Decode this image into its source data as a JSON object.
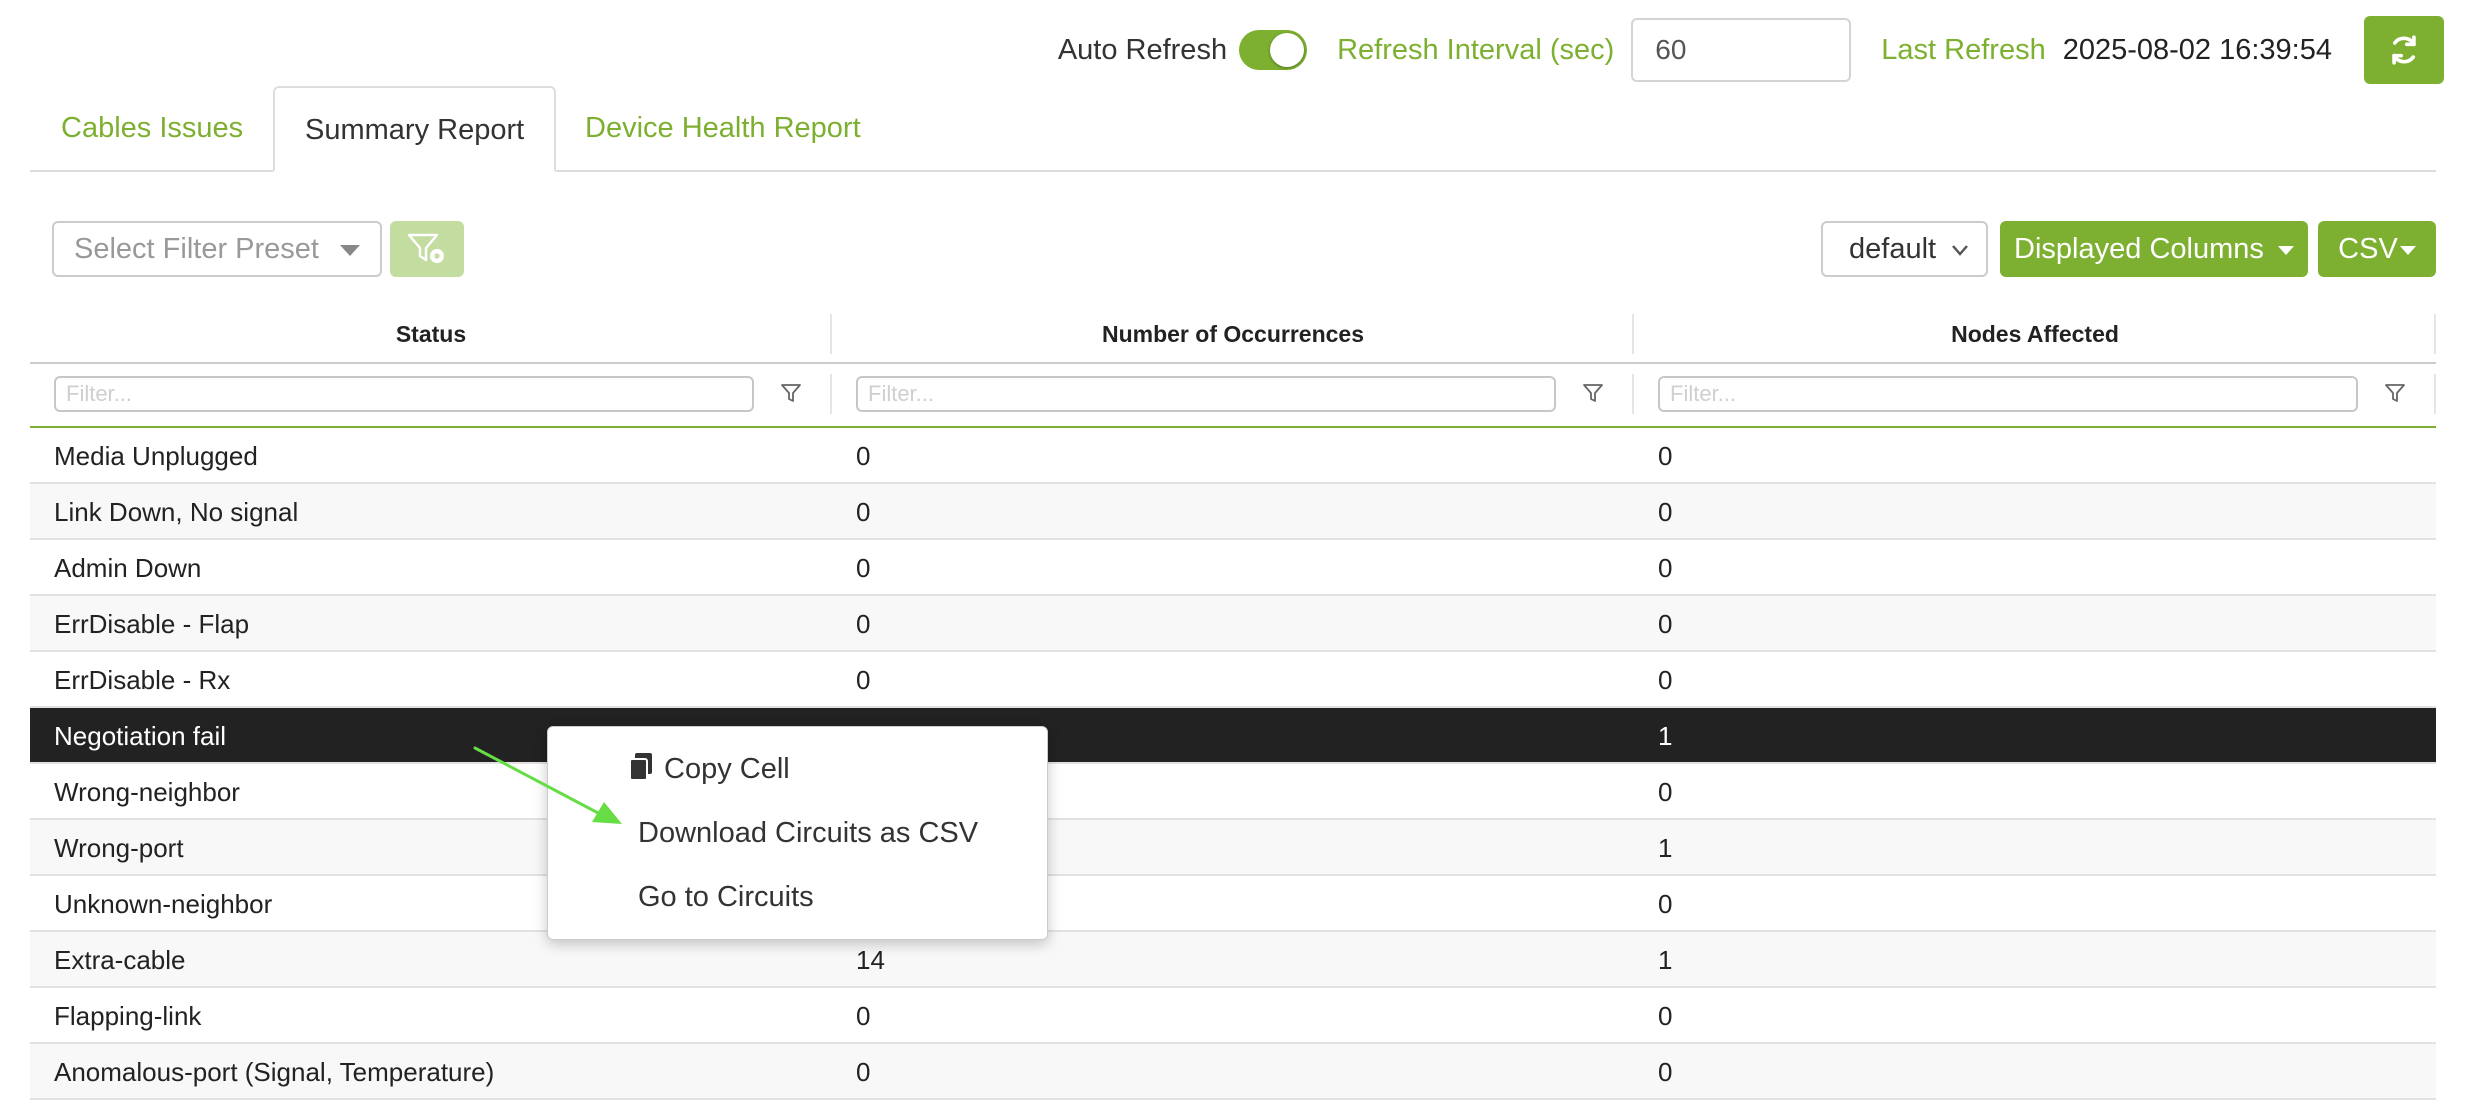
{
  "header": {
    "auto_refresh_label": "Auto Refresh",
    "auto_refresh_on": true,
    "refresh_interval_label": "Refresh Interval (sec)",
    "refresh_interval_value": "60",
    "last_refresh_label": "Last Refresh",
    "last_refresh_value": "2025-08-02 16:39:54",
    "refresh_icon": "refresh-icon"
  },
  "tabs": [
    {
      "label": "Cables Issues",
      "active": false
    },
    {
      "label": "Summary Report",
      "active": true
    },
    {
      "label": "Device Health Report",
      "active": false
    }
  ],
  "toolbar": {
    "filter_preset_placeholder": "Select Filter Preset",
    "filter_preset_icon": "filter-settings-icon",
    "view_select_value": "default",
    "displayed_columns_label": "Displayed Columns",
    "csv_label": "CSV"
  },
  "grid": {
    "columns": [
      "Status",
      "Number of Occurrences",
      "Nodes Affected"
    ],
    "filter_placeholder": "Filter...",
    "rows": [
      {
        "status": "Media Unplugged",
        "occurrences": "0",
        "nodes": "0"
      },
      {
        "status": "Link Down, No signal",
        "occurrences": "0",
        "nodes": "0"
      },
      {
        "status": "Admin Down",
        "occurrences": "0",
        "nodes": "0"
      },
      {
        "status": "ErrDisable - Flap",
        "occurrences": "0",
        "nodes": "0"
      },
      {
        "status": "ErrDisable - Rx",
        "occurrences": "0",
        "nodes": "0"
      },
      {
        "status": "Negotiation fail",
        "occurrences": "",
        "nodes": "1",
        "selected": true
      },
      {
        "status": "Wrong-neighbor",
        "occurrences": "",
        "nodes": "0"
      },
      {
        "status": "Wrong-port",
        "occurrences": "",
        "nodes": "1"
      },
      {
        "status": "Unknown-neighbor",
        "occurrences": "",
        "nodes": "0"
      },
      {
        "status": "Extra-cable",
        "occurrences": "14",
        "nodes": "1"
      },
      {
        "status": "Flapping-link",
        "occurrences": "0",
        "nodes": "0"
      },
      {
        "status": "Anomalous-port (Signal, Temperature)",
        "occurrences": "0",
        "nodes": "0"
      }
    ]
  },
  "context_menu": {
    "items": [
      {
        "label": "Copy Cell",
        "icon": "copy-icon"
      },
      {
        "label": "Download Circuits as CSV"
      },
      {
        "label": "Go to Circuits"
      }
    ]
  },
  "colors": {
    "accent": "#7db030",
    "selected_row": "#222222",
    "annotation_arrow": "#66dd44"
  }
}
